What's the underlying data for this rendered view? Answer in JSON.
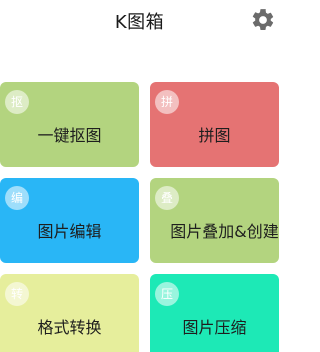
{
  "header": {
    "title": "K图箱",
    "settings_icon": "gear-icon"
  },
  "tiles": [
    {
      "badge": "抠",
      "label": "一键抠图",
      "color": "#b3d47f"
    },
    {
      "badge": "拼",
      "label": "拼图",
      "color": "#e57373"
    },
    {
      "badge": "编",
      "label": "图片编辑",
      "color": "#29b6f6"
    },
    {
      "badge": "叠",
      "label": "图片叠加&创建",
      "color": "#b3d47f"
    },
    {
      "badge": "转",
      "label": "格式转换",
      "color": "#e6ee9c"
    },
    {
      "badge": "压",
      "label": "图片压缩",
      "color": "#1de9b6"
    }
  ]
}
